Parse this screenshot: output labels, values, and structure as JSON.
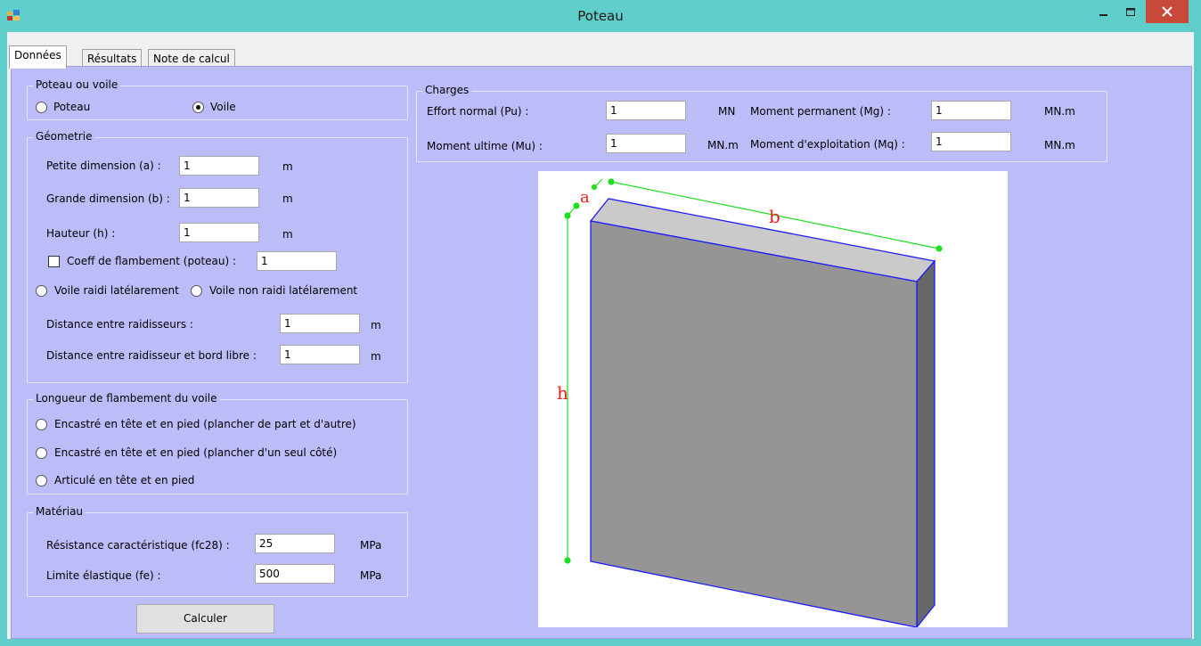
{
  "window": {
    "title": "Poteau",
    "accent": "#5fcdc9",
    "panel_bg": "#bcbcf8"
  },
  "tabs": [
    {
      "label": "Données",
      "active": true
    },
    {
      "label": "Résultats",
      "active": false
    },
    {
      "label": "Note de calcul",
      "active": false
    }
  ],
  "type_group": {
    "legend": "Poteau ou voile",
    "poteau": "Poteau",
    "voile": "Voile",
    "selected": "Voile"
  },
  "geometrie": {
    "legend": "Géometrie",
    "a_label": "Petite dimension (a) :",
    "a_value": "1",
    "a_unit": "m",
    "b_label": "Grande dimension (b) :",
    "b_value": "1",
    "b_unit": "m",
    "h_label": "Hauteur (h) :",
    "h_value": "1",
    "h_unit": "m",
    "coeff_label": "Coeff de flambement (poteau) :",
    "coeff_value": "1",
    "coeff_checked": false,
    "raidi_label": "Voile raidi latélarement",
    "non_raidi_label": "Voile non raidi latélarement",
    "dist_label": "Distance entre raidisseurs  :",
    "dist_value": "1",
    "dist_unit": "m",
    "bord_label": "Distance entre raidisseur et bord libre  :",
    "bord_value": "1",
    "bord_unit": "m"
  },
  "flambement": {
    "legend": "Longueur de flambement du voile",
    "opt1": "Encastré en tête et en pied (plancher de part et d'autre)",
    "opt2": "Encastré en tête et en pied (plancher d'un seul côté)",
    "opt3": "Articulé en tête et en pied"
  },
  "materiau": {
    "legend": "Matériau",
    "fc28_label": "Résistance caractéristique (fc28) :",
    "fc28_value": "25",
    "fc28_unit": "MPa",
    "fe_label": "Limite élastique (fe) :",
    "fe_value": "500",
    "fe_unit": "MPa"
  },
  "calculer_label": "Calculer",
  "charges": {
    "legend": "Charges",
    "pu_label": "Effort normal (Pu) :",
    "pu_value": "1",
    "pu_unit": "MN",
    "mg_label": "Moment permanent (Mg) :",
    "mg_value": "1",
    "mg_unit": "MN.m",
    "mu_label": "Moment ultime (Mu) :",
    "mu_value": "1",
    "mu_unit": "MN.m",
    "mq_label": "Moment d'exploitation (Mq) :",
    "mq_value": "1",
    "mq_unit": "MN.m"
  },
  "drawing": {
    "label_a": "a",
    "label_b": "b",
    "label_h": "h"
  }
}
